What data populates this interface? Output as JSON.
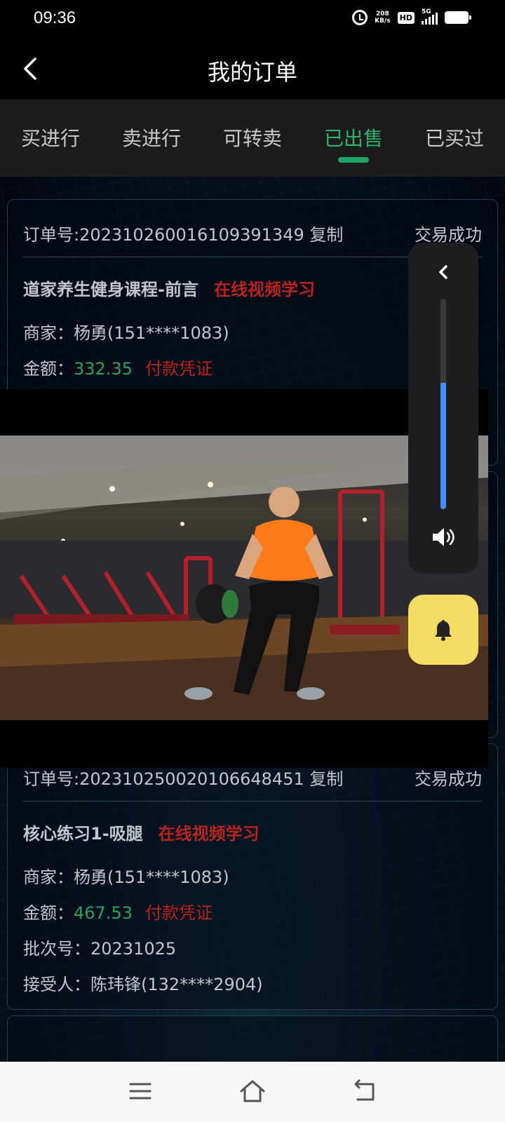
{
  "status_bar": {
    "time": "09:36",
    "speed_value": "208",
    "speed_unit": "KB/s",
    "hd_label": "HD",
    "network_label": "5G"
  },
  "header": {
    "title": "我的订单"
  },
  "tabs": [
    {
      "label": "买进行",
      "active": false
    },
    {
      "label": "卖进行",
      "active": false
    },
    {
      "label": "可转卖",
      "active": false
    },
    {
      "label": "已出售",
      "active": true
    },
    {
      "label": "已买过",
      "active": false
    }
  ],
  "orders": [
    {
      "order_no_text": "订单号:20231026001610939134​9 复制",
      "status": "交易成功",
      "course": "道家养生健身课程-前言",
      "course_type": "在线视频学习",
      "merchant_text": "商家：杨勇(151****1083)",
      "amount_label": "金额：",
      "amount": "332.35",
      "voucher": "付款凭证"
    },
    {
      "order_no_text": "订单号:20231025002010664845​1 复制",
      "status": "交易成功",
      "course": "核心练习1-吸腿",
      "course_type": "在线视频学习",
      "merchant_text": "商家：杨勇(151****1083)",
      "amount_label": "金额：",
      "amount": "467.53",
      "voucher": "付款凭证",
      "batch_text": "批次号：20231025",
      "receiver_text": "接受人：陈玮锋(132****2904)"
    }
  ],
  "volume": {
    "level": 0.6
  },
  "colors": {
    "accent_green": "#2db36b",
    "price_green": "#2aa15e",
    "link_red": "#b8241e",
    "bell_yellow": "#f5dd63",
    "volume_blue": "#3f8df5"
  }
}
